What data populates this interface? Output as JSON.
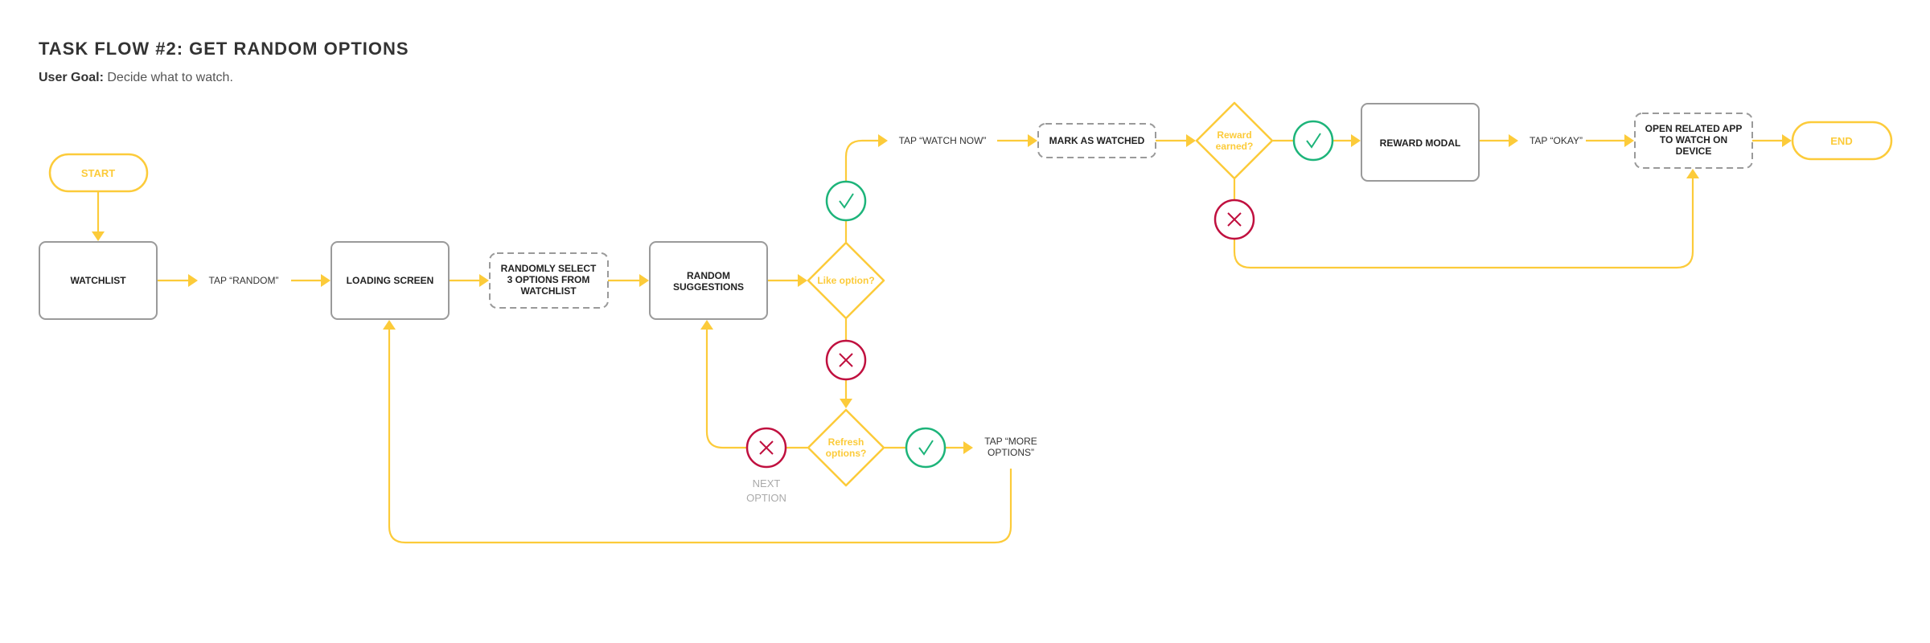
{
  "header": {
    "title": "TASK FLOW #2: GET RANDOM OPTIONS",
    "goal_label": "User Goal:",
    "goal_text": "Decide what to watch."
  },
  "colors": {
    "connector": "#FCCB3A",
    "yes": "#1DB47A",
    "no": "#C0103F",
    "box_border": "#9a9a9a",
    "text": "#222222",
    "note": "#aaaaaa"
  },
  "nodes": {
    "start": {
      "label": "START"
    },
    "watchlist": {
      "label": "WATCHLIST"
    },
    "tap_random": {
      "label": "TAP “RANDOM”"
    },
    "loading_screen": {
      "label": "LOADING SCREEN"
    },
    "randomly_select": {
      "lines": [
        "RANDOMLY SELECT",
        "3 OPTIONS FROM",
        "WATCHLIST"
      ]
    },
    "random_suggestions": {
      "lines": [
        "RANDOM",
        "SUGGESTIONS"
      ]
    },
    "like_option": {
      "label": "Like option?"
    },
    "tap_watch_now": {
      "label": "TAP “WATCH NOW”"
    },
    "mark_as_watched": {
      "label": "MARK AS WATCHED"
    },
    "reward_earned": {
      "lines": [
        "Reward",
        "earned?"
      ]
    },
    "reward_modal": {
      "label": "REWARD MODAL"
    },
    "tap_okay": {
      "label": "TAP “OKAY”"
    },
    "open_related_app": {
      "lines": [
        "OPEN RELATED APP",
        "TO WATCH ON",
        "DEVICE"
      ]
    },
    "end": {
      "label": "END"
    },
    "refresh_options": {
      "lines": [
        "Refresh",
        "options?"
      ]
    },
    "tap_more_options": {
      "lines": [
        "TAP “MORE",
        "OPTIONS”"
      ]
    },
    "next_option": {
      "lines": [
        "NEXT",
        "OPTION"
      ]
    }
  },
  "icons": {
    "yes": "check-icon",
    "no": "x-icon"
  }
}
